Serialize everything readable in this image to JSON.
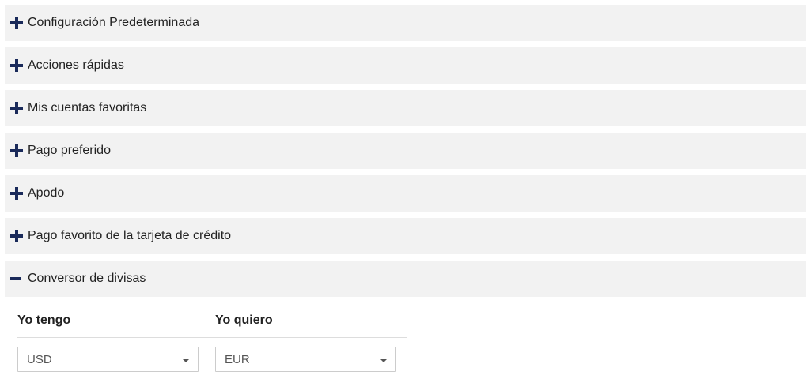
{
  "sections": [
    {
      "label": "Configuración Predeterminada",
      "expanded": false,
      "icon": "plus-icon"
    },
    {
      "label": "Acciones rápidas",
      "expanded": false,
      "icon": "plus-icon"
    },
    {
      "label": "Mis cuentas favoritas",
      "expanded": false,
      "icon": "plus-icon"
    },
    {
      "label": "Pago preferido",
      "expanded": false,
      "icon": "plus-icon"
    },
    {
      "label": "Apodo",
      "expanded": false,
      "icon": "plus-icon"
    },
    {
      "label": "Pago favorito de la tarjeta de crédito",
      "expanded": false,
      "icon": "plus-icon"
    },
    {
      "label": "Conversor de divisas",
      "expanded": true,
      "icon": "minus-icon"
    }
  ],
  "converter": {
    "have_label": "Yo tengo",
    "want_label": "Yo quiero",
    "have_value": "USD",
    "want_value": "EUR"
  },
  "colors": {
    "icon": "#1a2a5a",
    "section_bg": "#f2f2f2"
  }
}
